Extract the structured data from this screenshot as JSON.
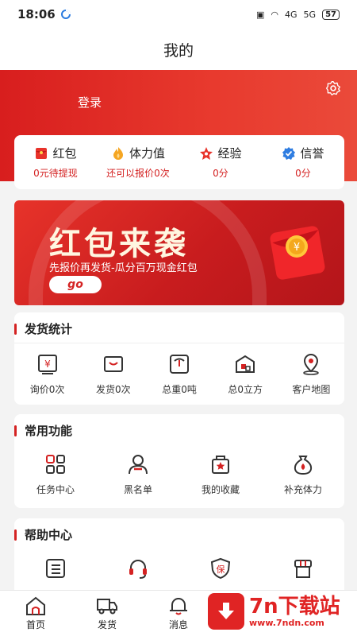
{
  "status_bar": {
    "time": "18:06",
    "signal_1": "4G",
    "signal_2": "5G",
    "battery": "57"
  },
  "header": {
    "title": "我的"
  },
  "profile": {
    "login_label": "登录"
  },
  "stats": [
    {
      "label": "红包",
      "value": "0元待提现",
      "icon": "red-packet-icon"
    },
    {
      "label": "体力值",
      "value": "还可以报价0次",
      "icon": "flame-icon"
    },
    {
      "label": "经验",
      "value": "0分",
      "icon": "star-badge-icon"
    },
    {
      "label": "信誉",
      "value": "0分",
      "icon": "shield-check-icon"
    }
  ],
  "banner": {
    "title": "红包来袭",
    "subtitle": "先报价再发货-瓜分百万现金红包",
    "button": "go",
    "coin_symbol": "¥"
  },
  "shipping_stats": {
    "title": "发货统计",
    "items": [
      {
        "label": "询价0次",
        "icon": "inquiry-icon"
      },
      {
        "label": "发货0次",
        "icon": "box-icon"
      },
      {
        "label": "总重0吨",
        "icon": "scale-icon"
      },
      {
        "label": "总0立方",
        "icon": "warehouse-icon"
      },
      {
        "label": "客户地图",
        "icon": "map-pin-icon"
      }
    ]
  },
  "common_functions": {
    "title": "常用功能",
    "items": [
      {
        "label": "任务中心",
        "icon": "task-center-icon"
      },
      {
        "label": "黑名单",
        "icon": "blacklist-icon"
      },
      {
        "label": "我的收藏",
        "icon": "favorites-icon"
      },
      {
        "label": "补充体力",
        "icon": "energy-bag-icon"
      }
    ]
  },
  "help_center": {
    "title": "帮助中心",
    "items": [
      {
        "label": "",
        "icon": "complaint-list-icon"
      },
      {
        "label": "",
        "icon": "headset-icon"
      },
      {
        "label": "保",
        "icon": "insurance-icon"
      },
      {
        "label": "",
        "icon": "store-icon"
      }
    ]
  },
  "bottom_nav": [
    {
      "label": "首页",
      "icon": "home-icon"
    },
    {
      "label": "发货",
      "icon": "truck-icon"
    },
    {
      "label": "消息",
      "icon": "bell-icon"
    }
  ],
  "watermark": {
    "text": "7n下载站",
    "url": "www.7ndn.com"
  },
  "colors": {
    "brand_red": "#d42222",
    "header_red": "#e0302a",
    "background": "#f3f3f3"
  }
}
